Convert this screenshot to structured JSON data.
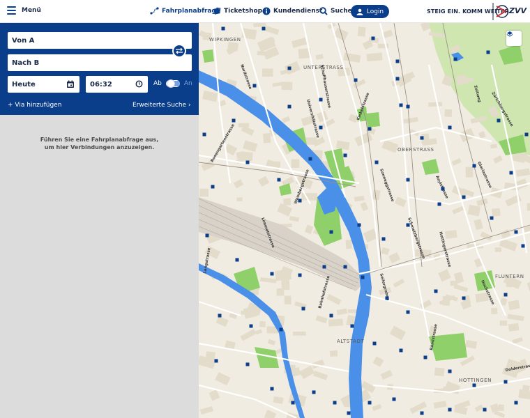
{
  "header": {
    "menu_label": "Menü",
    "nav": [
      {
        "label": "Fahrplanabfrage",
        "icon": "route-icon",
        "active": true
      },
      {
        "label": "Ticketshop",
        "icon": "ticket-icon",
        "active": false
      },
      {
        "label": "Kundendienst",
        "icon": "info-icon",
        "active": false
      },
      {
        "label": "Suche",
        "icon": "search-icon",
        "active": false
      }
    ],
    "login_label": "Login",
    "slogan": "STEIG EIN. KOMM WEITER.",
    "logo_text": "ZVV"
  },
  "search": {
    "from_placeholder": "Von A",
    "to_placeholder": "Nach B",
    "date_value": "Heute",
    "time_value": "06:32",
    "mode_ab": "Ab",
    "mode_an": "An",
    "via_label": "+ Via hinzufügen",
    "advanced_label": "Erweiterte Suche ›"
  },
  "results": {
    "hint_line1": "Führen Sie eine Fahrplanabfrage aus,",
    "hint_line2": "um hier Verbindungen anzuzeigen."
  },
  "map": {
    "districts": [
      "WIPKINGEN",
      "UNTERSTRASS",
      "OBERSTRASS",
      "FLUNTERN",
      "ALTSTADT",
      "HOTTINGEN"
    ],
    "streets": [
      "Rosengartenstrasse",
      "Nordstrasse",
      "Schaffhauserstrasse",
      "Weinbergstrasse",
      "Universitätstrasse",
      "Limmatstrasse",
      "Langstrasse",
      "Bahnhofstrasse",
      "Rämistrasse",
      "Seilergraben",
      "Zeltweg",
      "Dolderstrasse",
      "Gloriastrasse",
      "Hochstrasse",
      "Schmelzbergstrasse",
      "Sonneggstrasse",
      "Hottingerstrasse",
      "Zürichbergstrasse",
      "Kinkelstrasse",
      "Asylstrasse"
    ],
    "colors": {
      "water": "#4a90e8",
      "park": "#8fd06a",
      "block": "#e6dfcf",
      "stop": "#0a3e8a",
      "forest": "#cfe6b0"
    }
  }
}
